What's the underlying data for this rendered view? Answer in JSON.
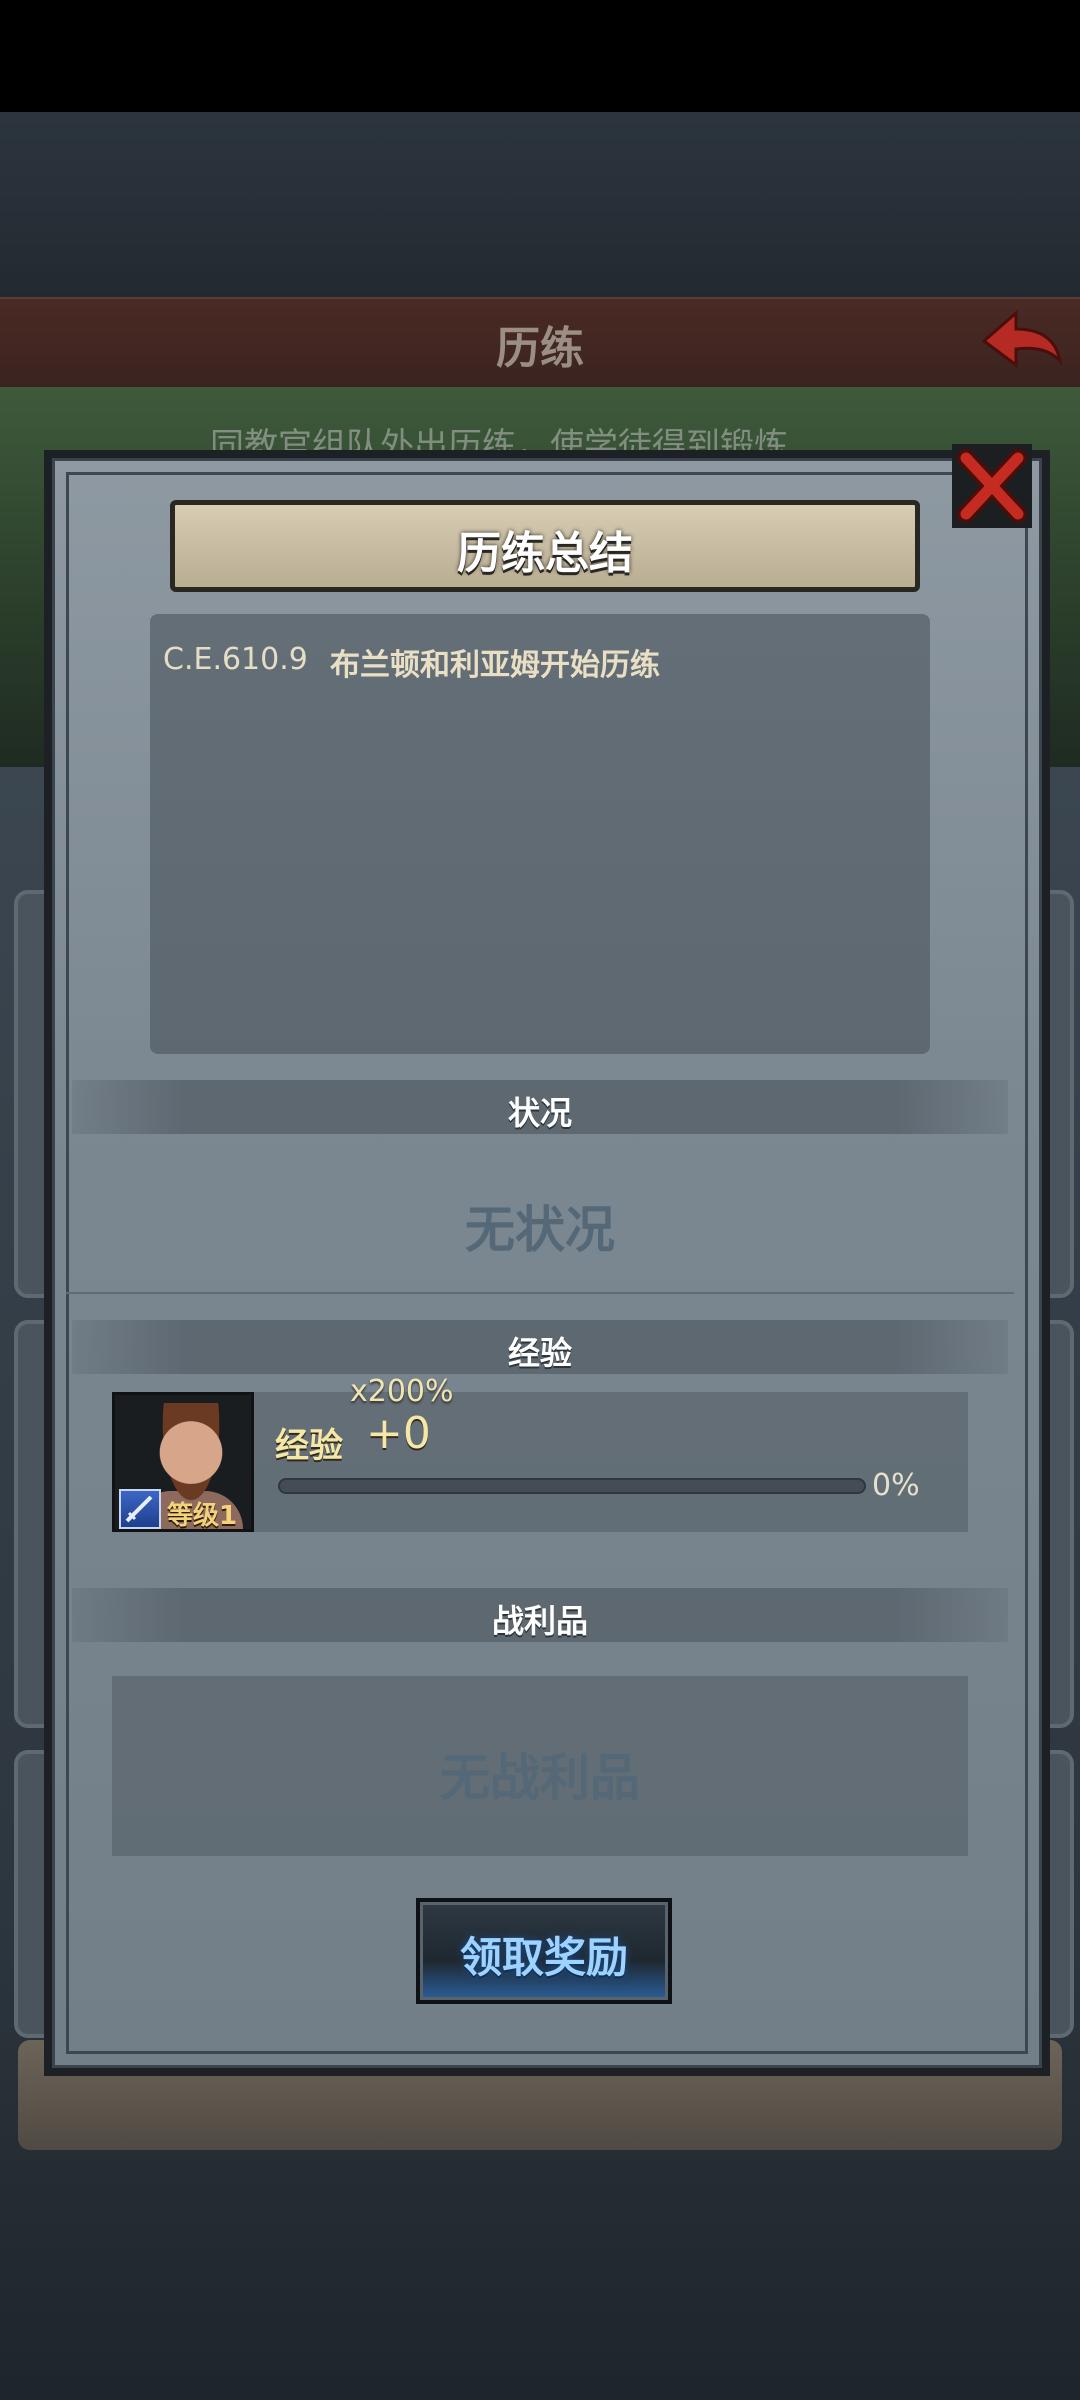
{
  "header": {
    "title": "历练",
    "background_subtitle": "同教官组队外出历练，使学徒得到锻炼"
  },
  "modal": {
    "title": "历练总结",
    "log": [
      {
        "date": "C.E.610.9",
        "text": "布兰顿和利亚姆开始历练"
      }
    ],
    "status_section": {
      "label": "状况",
      "empty_text": "无状况"
    },
    "exp_section": {
      "label": "经验",
      "multiplier": "x200%",
      "exp_label": "经验",
      "exp_value": "+0",
      "level_label": "等级",
      "level_value": "1",
      "progress_percent_text": "0%",
      "progress_fraction": 0
    },
    "loot_section": {
      "label": "战利品",
      "empty_text": "无战利品"
    },
    "claim_button": "领取奖励"
  },
  "icons": {
    "close": "close-x-icon",
    "back": "back-arrow-icon",
    "skill": "sword-icon"
  },
  "colors": {
    "accent_red": "#b52a22",
    "button_glow": "#2a5f9c",
    "exp_text": "#f6e7a6"
  }
}
